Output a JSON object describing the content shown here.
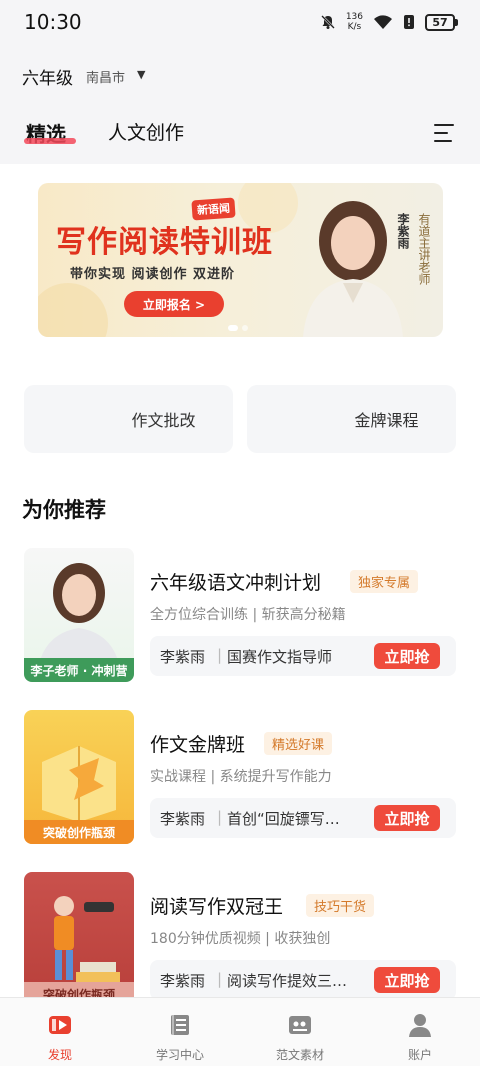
{
  "status": {
    "time": "10:30",
    "speed_value": "136",
    "speed_unit": "K/s",
    "battery": "57"
  },
  "header": {
    "grade": "六年级",
    "city": "南昌市",
    "tabs": [
      {
        "label": "精选",
        "selected": true
      },
      {
        "label": "人文创作",
        "selected": false
      }
    ]
  },
  "banner": {
    "badge": "新语闻",
    "title": "写作阅读特训班",
    "subtitle": "带你实现 阅读创作 双进阶",
    "button": "立即报名 >",
    "teacher": "李紫雨",
    "role": "有道主讲老师"
  },
  "features": [
    "作文批改",
    "金牌课程"
  ],
  "section_title": "为你推荐",
  "items": [
    {
      "title": "六年级语文冲刺计划",
      "tag": "独家专属",
      "desc": "全方位综合训练 | 斩获高分秘籍",
      "teacher": "李紫雨",
      "info": "国赛作文指导师",
      "button": "立即抢",
      "thumb_caption": "李子老师 · 冲刺营"
    },
    {
      "title": "作文金牌班",
      "tag": "精选好课",
      "desc": "实战课程 | 系统提升写作能力",
      "teacher": "李紫雨",
      "info": "首创“回旋镖写…",
      "button": "立即抢",
      "thumb_caption": "突破创作瓶颈"
    },
    {
      "title": "阅读写作双冠王",
      "tag": "技巧干货",
      "desc": "180分钟优质视频 | 收获独创",
      "teacher": "李紫雨",
      "info": "阅读写作提效三…",
      "button": "立即抢",
      "thumb_caption": "突破创作瓶颈"
    }
  ],
  "nav": [
    {
      "label": "发现",
      "icon": "play-video-icon",
      "active": true
    },
    {
      "label": "学习中心",
      "icon": "book-icon",
      "active": false
    },
    {
      "label": "范文素材",
      "icon": "quote-doc-icon",
      "active": false
    },
    {
      "label": "账户",
      "icon": "person-icon",
      "active": false
    }
  ],
  "colors": {
    "accent": "#e9402f",
    "tag_bg": "#fdf1e3",
    "tag_text": "#d47a2b"
  }
}
